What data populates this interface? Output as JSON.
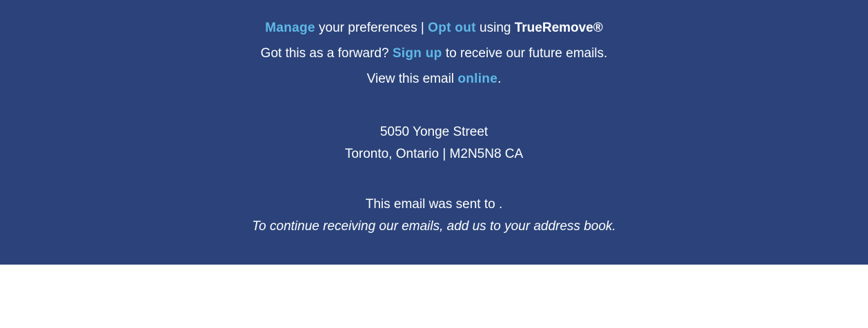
{
  "footer": {
    "line1": {
      "manage_link": "Manage",
      "preferences_text": " your preferences | ",
      "optout_link": "Opt out",
      "using_text": " using ",
      "brand": "TrueRemove®"
    },
    "line2": {
      "prefix": "Got this as a forward? ",
      "signup_link": "Sign up",
      "suffix": " to receive our future emails."
    },
    "line3": {
      "prefix": "View this email ",
      "online_link": "online",
      "suffix": "."
    },
    "address": {
      "street": "5050 Yonge Street",
      "city_line": "Toronto, Ontario | M2N5N8 CA"
    },
    "sent_to": "This email was sent to .",
    "address_book_note": "To continue receiving our emails, add us to your address book."
  },
  "colors": {
    "footer_background": "#2b437a",
    "link": "#5fb8e8",
    "text": "#ffffff"
  }
}
